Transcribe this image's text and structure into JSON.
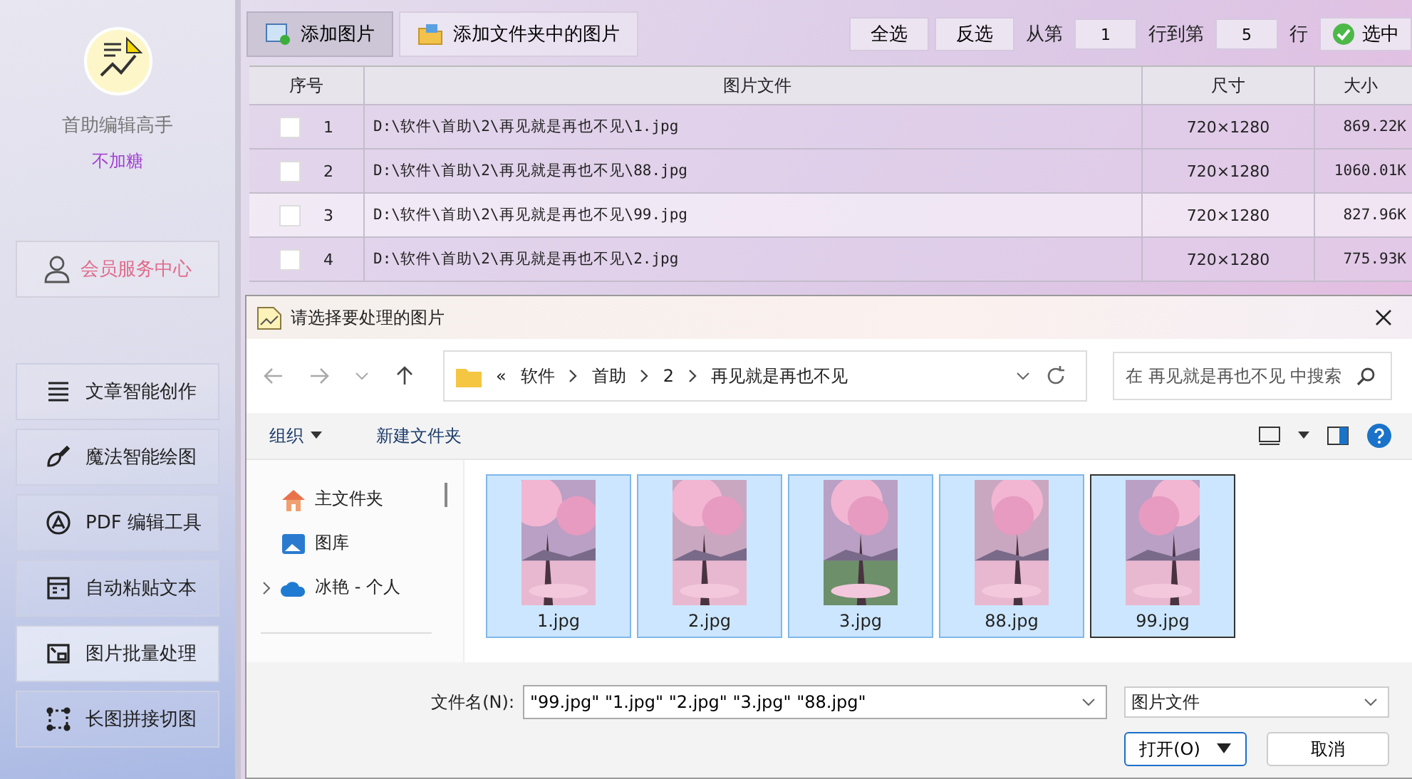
{
  "sidebar": {
    "app_name": "首助编辑高手",
    "user": "不加糖",
    "member_button": "会员服务中心",
    "items": [
      {
        "label": "文章智能创作",
        "selected": false
      },
      {
        "label": "魔法智能绘图",
        "selected": false
      },
      {
        "label": "PDF 编辑工具",
        "selected": false
      },
      {
        "label": "自动粘贴文本",
        "selected": false
      },
      {
        "label": "图片批量处理",
        "selected": true
      },
      {
        "label": "长图拼接切图",
        "selected": false
      }
    ]
  },
  "toolbar": {
    "add_image": "添加图片",
    "add_folder": "添加文件夹中的图片",
    "select_all": "全选",
    "invert": "反选",
    "from_label": "从第",
    "from_value": "1",
    "to_label": "行到第",
    "to_value": "5",
    "row_label": "行",
    "select_button": "选中"
  },
  "table": {
    "columns": [
      "序号",
      "图片文件",
      "尺寸",
      "大小"
    ],
    "rows": [
      {
        "index": "1",
        "file": "D:\\软件\\首助\\2\\再见就是再也不见\\1.jpg",
        "size": "720×1280",
        "bytes": "869.22K",
        "checked": false
      },
      {
        "index": "2",
        "file": "D:\\软件\\首助\\2\\再见就是再也不见\\88.jpg",
        "size": "720×1280",
        "bytes": "1060.01K",
        "checked": false
      },
      {
        "index": "3",
        "file": "D:\\软件\\首助\\2\\再见就是再也不见\\99.jpg",
        "size": "720×1280",
        "bytes": "827.96K",
        "checked": false
      },
      {
        "index": "4",
        "file": "D:\\软件\\首助\\2\\再见就是再也不见\\2.jpg",
        "size": "720×1280",
        "bytes": "775.93K",
        "checked": false
      }
    ]
  },
  "dialog": {
    "title": "请选择要处理的图片",
    "breadcrumb": [
      "«",
      "软件",
      "首助",
      "2",
      "再见就是再也不见"
    ],
    "search": {
      "placeholder": "在 再见就是再也不见 中搜索"
    },
    "organize": "组织",
    "new_folder": "新建文件夹",
    "nav": [
      {
        "label": "主文件夹",
        "expandable": false
      },
      {
        "label": "图库",
        "expandable": false
      },
      {
        "label": "冰艳 - 个人",
        "expandable": true
      }
    ],
    "files": [
      {
        "name": "1.jpg",
        "selected": true,
        "focused": false
      },
      {
        "name": "2.jpg",
        "selected": true,
        "focused": false
      },
      {
        "name": "3.jpg",
        "selected": true,
        "focused": false
      },
      {
        "name": "88.jpg",
        "selected": true,
        "focused": false
      },
      {
        "name": "99.jpg",
        "selected": true,
        "focused": true
      }
    ],
    "filename_label": "文件名(N):",
    "filename_value": "\"99.jpg\" \"1.jpg\" \"2.jpg\" \"3.jpg\" \"88.jpg\"",
    "filetype": "图片文件",
    "open_button": "打开(O)",
    "cancel_button": "取消"
  }
}
